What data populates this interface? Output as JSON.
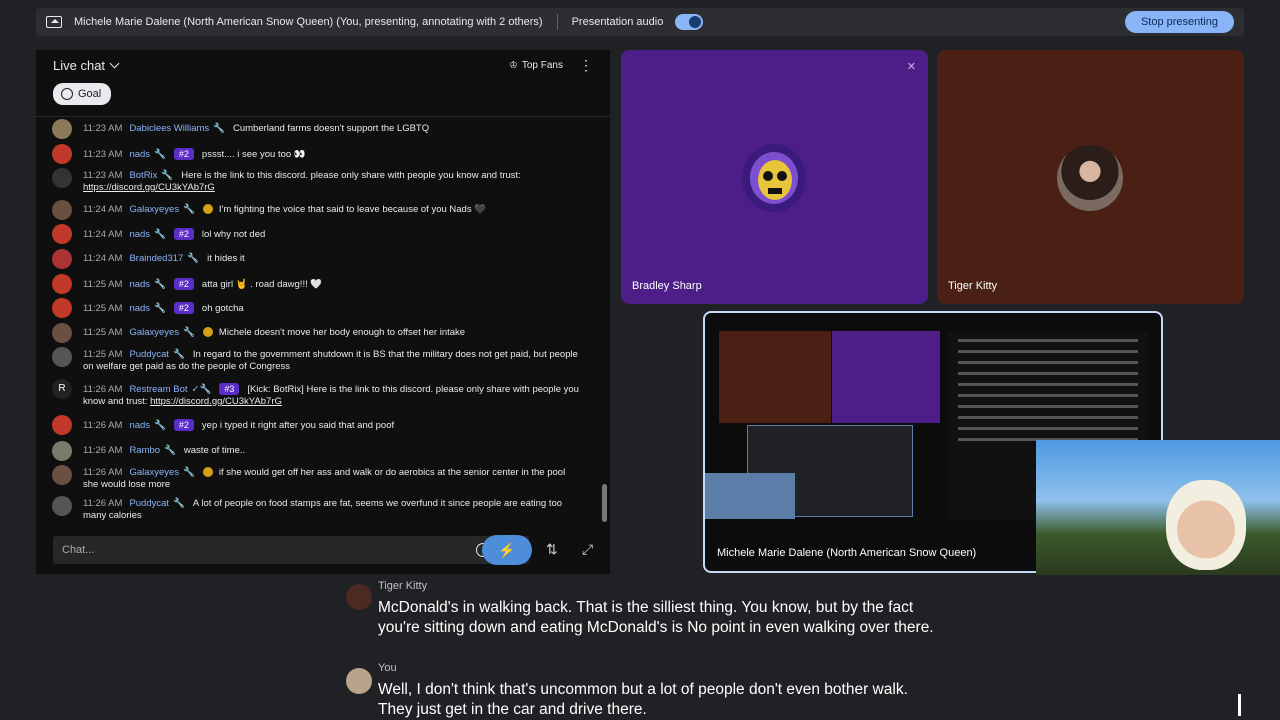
{
  "topbar": {
    "presenter_text": "Michele Marie Dalene (North American Snow Queen) (You, presenting, annotating with 2 others)",
    "audio_label": "Presentation audio",
    "stop_label": "Stop presenting"
  },
  "chat": {
    "header": "Live chat",
    "top_fans": "Top Fans",
    "goal": "Goal",
    "input_placeholder": "Chat...",
    "messages": [
      {
        "time": "11:23 AM",
        "author": "Dabiclees Williams",
        "badge": "",
        "text": "Cumberland farms doesn't support the LGBTQ"
      },
      {
        "time": "11:23 AM",
        "author": "nads",
        "badge": "#2",
        "text": "pssst.... i see you too 👀"
      },
      {
        "time": "11:23 AM",
        "author": "BotRix",
        "badge": "",
        "text": "Here is the link to this discord. please only share with people you know and trust:",
        "link": "https://discord.gg/CU3kYAb7rG"
      },
      {
        "time": "11:24 AM",
        "author": "Galaxyeyes",
        "badge": "",
        "text": "I'm fighting the voice that said to leave because of you Nads 🖤"
      },
      {
        "time": "11:24 AM",
        "author": "nads",
        "badge": "#2",
        "text": "lol why not ded"
      },
      {
        "time": "11:24 AM",
        "author": "Brainded317",
        "badge": "",
        "text": "it hides it"
      },
      {
        "time": "11:25 AM",
        "author": "nads",
        "badge": "#2",
        "text": "atta girl 🤘 . road dawg!!! 🤍"
      },
      {
        "time": "11:25 AM",
        "author": "nads",
        "badge": "#2",
        "text": "oh gotcha"
      },
      {
        "time": "11:25 AM",
        "author": "Galaxyeyes",
        "badge": "",
        "text": "Michele doesn't move her body enough to offset her intake"
      },
      {
        "time": "11:25 AM",
        "author": "Puddycat",
        "badge": "",
        "text": "In regard to the government shutdown it is BS that the military does not get paid, but people on welfare get paid as do the people of Congress"
      },
      {
        "time": "11:26 AM",
        "author": "Restream Bot",
        "badge": "#3",
        "text": "[Kick: BotRix] Here is the link to this discord. please only share with people you know and trust:",
        "link": "https://discord.gg/CU3kYAb7rG"
      },
      {
        "time": "11:26 AM",
        "author": "nads",
        "badge": "#2",
        "text": "yep i typed it right after you said that and poof"
      },
      {
        "time": "11:26 AM",
        "author": "Rambo",
        "badge": "",
        "text": "waste of time.."
      },
      {
        "time": "11:26 AM",
        "author": "Galaxyeyes",
        "badge": "",
        "text": "if she would get off her ass and walk or do aerobics at the senior center in the pool she would lose more"
      },
      {
        "time": "11:26 AM",
        "author": "Puddycat",
        "badge": "",
        "text": "A lot of people on food stamps are fat, seems we overfund it since people are eating too many calories"
      }
    ]
  },
  "tiles": {
    "bradley": "Bradley Sharp",
    "tiger": "Tiger Kitty",
    "presenter": "Michele Marie Dalene (North American Snow Queen)"
  },
  "captions": [
    {
      "name": "Tiger Kitty",
      "text": "McDonald's in walking back. That is the silliest thing. You know, but by the fact you're sitting down and eating McDonald's is No point in even walking over there."
    },
    {
      "name": "You",
      "text": "Well, I don't think that's uncommon but a lot of people don't even bother walk. They just get in the car and drive there."
    }
  ],
  "colors": {
    "accent": "#8ab4f8",
    "badge": "#5b2dc8",
    "author": "#8ab4f8"
  }
}
